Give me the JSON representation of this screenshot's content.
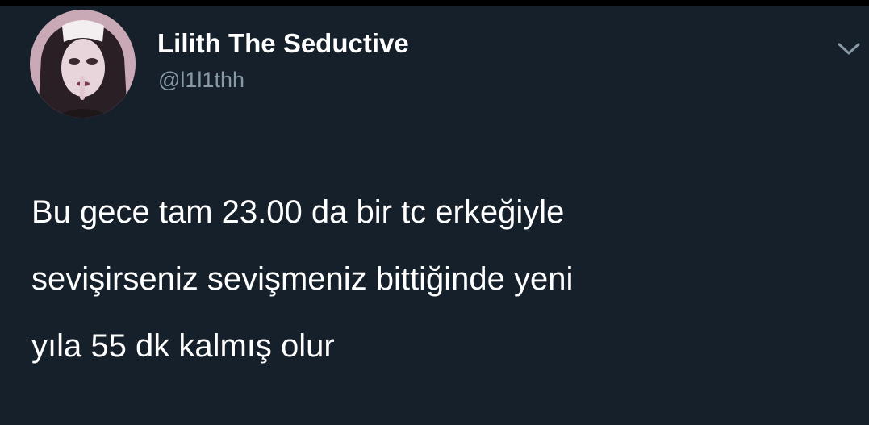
{
  "tweet": {
    "author": {
      "display_name": "Lilith The Seductive",
      "handle": "@l1l1thh",
      "avatar": "profile-photo"
    },
    "text_lines": [
      "Bu gece tam 23.00 da bir tc erkeğiyle",
      "sevişirseniz sevişmeniz bittiğinde yeni",
      "yıla 55 dk kalmış olur"
    ],
    "menu_icon": "chevron-down-icon"
  },
  "colors": {
    "background": "#15202b",
    "text_primary": "#ffffff",
    "text_secondary": "#8899a6"
  }
}
